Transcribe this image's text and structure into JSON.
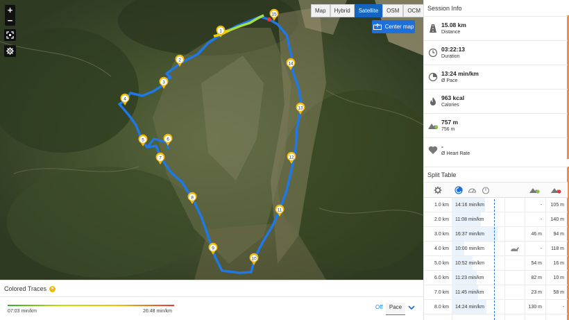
{
  "map": {
    "zoom_in": "+",
    "zoom_out": "−",
    "map_types": [
      "Map",
      "Hybrid",
      "Satellite",
      "OSM",
      "OCM"
    ],
    "active_map_type": "Satellite",
    "center_map_label": "Center map",
    "km_markers": [
      "1",
      "2",
      "3",
      "4",
      "5",
      "6",
      "7",
      "8",
      "9",
      "10",
      "11",
      "12",
      "13",
      "14",
      "15"
    ],
    "route_color": "#1e78e6",
    "marker_color": "#f5b800"
  },
  "colored_traces": {
    "title": "Colored Traces",
    "min_label": "07:03 min/km",
    "max_label": "26:48 min/km",
    "off_label": "Off",
    "mode_label": "Pace"
  },
  "session_info": {
    "title": "Session Info",
    "stats": [
      {
        "value": "15.08 km",
        "label": "Distance",
        "icon": "distance-icon"
      },
      {
        "value": "03:22:13",
        "label": "Duration",
        "icon": "clock-icon"
      },
      {
        "value": "13:24 min/km",
        "label": "Ø Pace",
        "icon": "pace-icon"
      },
      {
        "value": "963 kcal",
        "label": "Calories",
        "icon": "flame-icon"
      },
      {
        "value": "757 m",
        "label": "756 m",
        "icon": "elevation-icon"
      },
      {
        "value": "-",
        "label": "Ø Heart Rate",
        "icon": "heart-icon"
      }
    ]
  },
  "split_table": {
    "title": "Split Table",
    "rows": [
      {
        "km": "1.0 km",
        "pace": "14:16 min/km",
        "pace_frac": 0.4,
        "up": "-",
        "down": "105 m",
        "icon": ""
      },
      {
        "km": "2.0 km",
        "pace": "11:08 min/km",
        "pace_frac": 0.35,
        "up": "-",
        "down": "140 m",
        "icon": ""
      },
      {
        "km": "3.0 km",
        "pace": "16:37 min/km",
        "pace_frac": 0.55,
        "up": "46 m",
        "down": "94 m",
        "icon": ""
      },
      {
        "km": "4.0 km",
        "pace": "10:00 min/km",
        "pace_frac": 0.15,
        "up": "-",
        "down": "118 m",
        "icon": "rabbit-icon"
      },
      {
        "km": "5.0 km",
        "pace": "10:52 min/km",
        "pace_frac": 0.25,
        "up": "54 m",
        "down": "16 m",
        "icon": ""
      },
      {
        "km": "6.0 km",
        "pace": "11:23 min/km",
        "pace_frac": 0.3,
        "up": "82 m",
        "down": "10 m",
        "icon": ""
      },
      {
        "km": "7.0 km",
        "pace": "11:45 min/km",
        "pace_frac": 0.32,
        "up": "23 m",
        "down": "58 m",
        "icon": ""
      },
      {
        "km": "8.0 km",
        "pace": "14:24 min/km",
        "pace_frac": 0.42,
        "up": "130 m",
        "down": "-",
        "icon": ""
      }
    ]
  }
}
